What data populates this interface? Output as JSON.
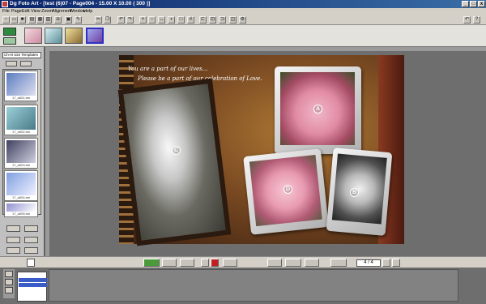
{
  "window": {
    "title": "Dg Foto Art - [test (6)07 - Page004 - 15.00 X 10.00 ( 300 )]",
    "controls": [
      "_",
      "□",
      "x"
    ]
  },
  "menu": [
    "File",
    "Page",
    "Edit",
    "View",
    "Zoom",
    "Alignment",
    "Window",
    "Help"
  ],
  "left_panel": {
    "dropdown_value": "Ch-III size Templates",
    "thumb_captions": [
      "17_a001.tmi",
      "17_a002.tmi",
      "17_a003.tmi",
      "17_a004.tmi",
      "17_a005.tmi"
    ]
  },
  "canvas": {
    "caption_line1": "You are a part of our lives...",
    "caption_line2": "Please be a part of our celebration of Love.",
    "markers": [
      "A",
      "B",
      "C",
      "D"
    ]
  },
  "bottom_bar": {
    "page_indicator": "4 / 4"
  },
  "colors": {
    "titlebar": "#0a246a",
    "chrome": "#d4d0c8",
    "workspace": "#6e6e6e",
    "rose_pink": "#e89ab0"
  }
}
